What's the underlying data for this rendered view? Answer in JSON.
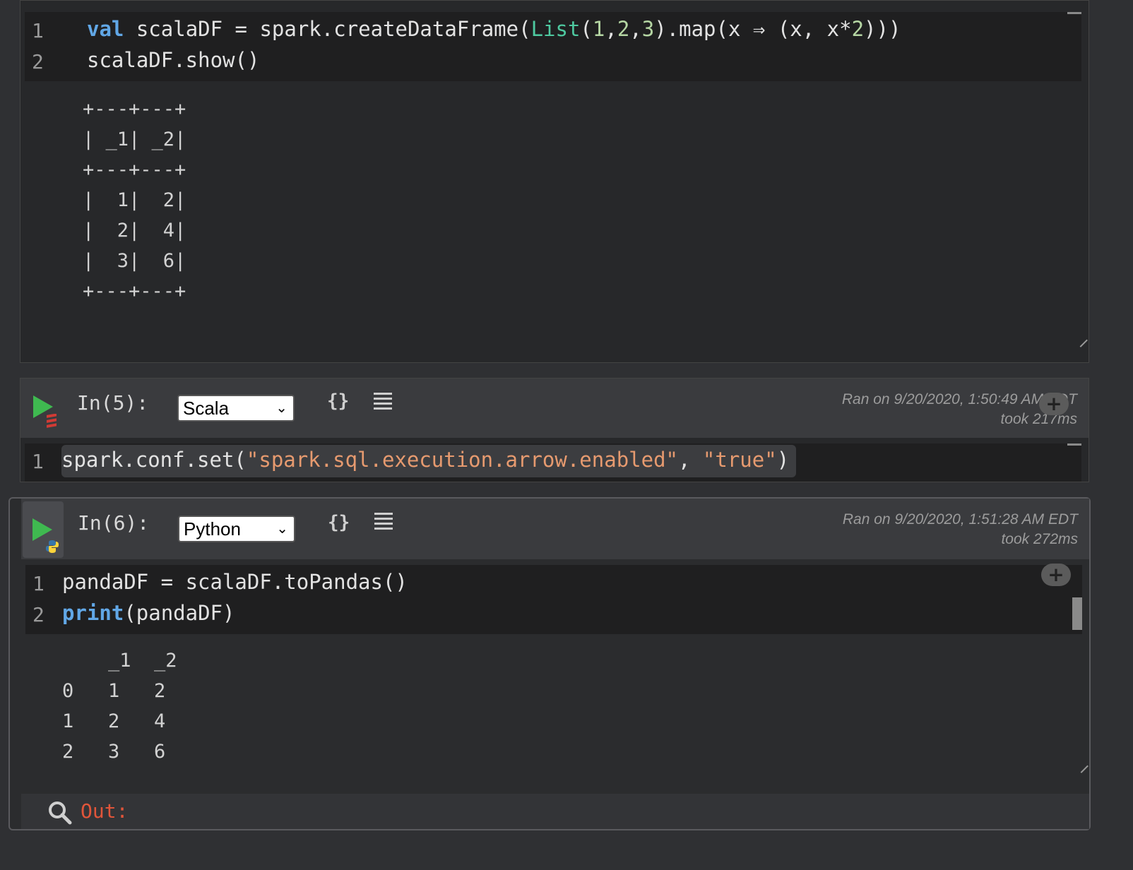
{
  "cell4": {
    "lines": [
      {
        "num": "1",
        "tokens": [
          {
            "t": "val",
            "c": "kw"
          },
          {
            "t": " scalaDF = spark.createDataFrame(",
            "c": ""
          },
          {
            "t": "List",
            "c": "ty"
          },
          {
            "t": "(",
            "c": ""
          },
          {
            "t": "1",
            "c": "num"
          },
          {
            "t": ",",
            "c": ""
          },
          {
            "t": "2",
            "c": "num"
          },
          {
            "t": ",",
            "c": ""
          },
          {
            "t": "3",
            "c": "num"
          },
          {
            "t": ").map(x ⇒ (x, x*",
            "c": ""
          },
          {
            "t": "2",
            "c": "num"
          },
          {
            "t": ")))",
            "c": ""
          }
        ]
      },
      {
        "num": "2",
        "tokens": [
          {
            "t": "scalaDF.show()",
            "c": ""
          }
        ]
      }
    ],
    "output": [
      "+---+---+",
      "| _1| _2|",
      "+---+---+",
      "|  1|  2|",
      "|  2|  4|",
      "|  3|  6|",
      "+---+---+"
    ]
  },
  "cell5": {
    "prompt": "In(5):",
    "language": "Scala",
    "braces": "{}",
    "ran_on": "Ran on 9/20/2020, 1:50:49 AM EDT",
    "took": "took 217ms",
    "lines": [
      {
        "num": "1",
        "tokens": [
          {
            "t": "spark.conf.set(",
            "c": ""
          },
          {
            "t": "\"spark.sql.execution.arrow.enabled\"",
            "c": "str"
          },
          {
            "t": ", ",
            "c": ""
          },
          {
            "t": "\"true\"",
            "c": "str"
          },
          {
            "t": ")",
            "c": ""
          }
        ]
      }
    ]
  },
  "cell6": {
    "prompt": "In(6):",
    "language": "Python",
    "braces": "{}",
    "ran_on": "Ran on 9/20/2020, 1:51:28 AM EDT",
    "took": "took 272ms",
    "lines": [
      {
        "num": "1",
        "tokens": [
          {
            "t": "pandaDF = scalaDF.toPandas()",
            "c": ""
          }
        ]
      },
      {
        "num": "2",
        "tokens": [
          {
            "t": "print",
            "c": "kw"
          },
          {
            "t": "(pandaDF)",
            "c": ""
          }
        ]
      }
    ],
    "output": [
      "    _1  _2",
      "0   1   2",
      "1   2   4",
      "2   3   6"
    ],
    "out_label": "Out:"
  },
  "icons": [
    "play-icon",
    "scala-logo-icon",
    "python-logo-icon",
    "list-icon",
    "add-cell-icon",
    "search-icon",
    "resize-handle-icon"
  ]
}
